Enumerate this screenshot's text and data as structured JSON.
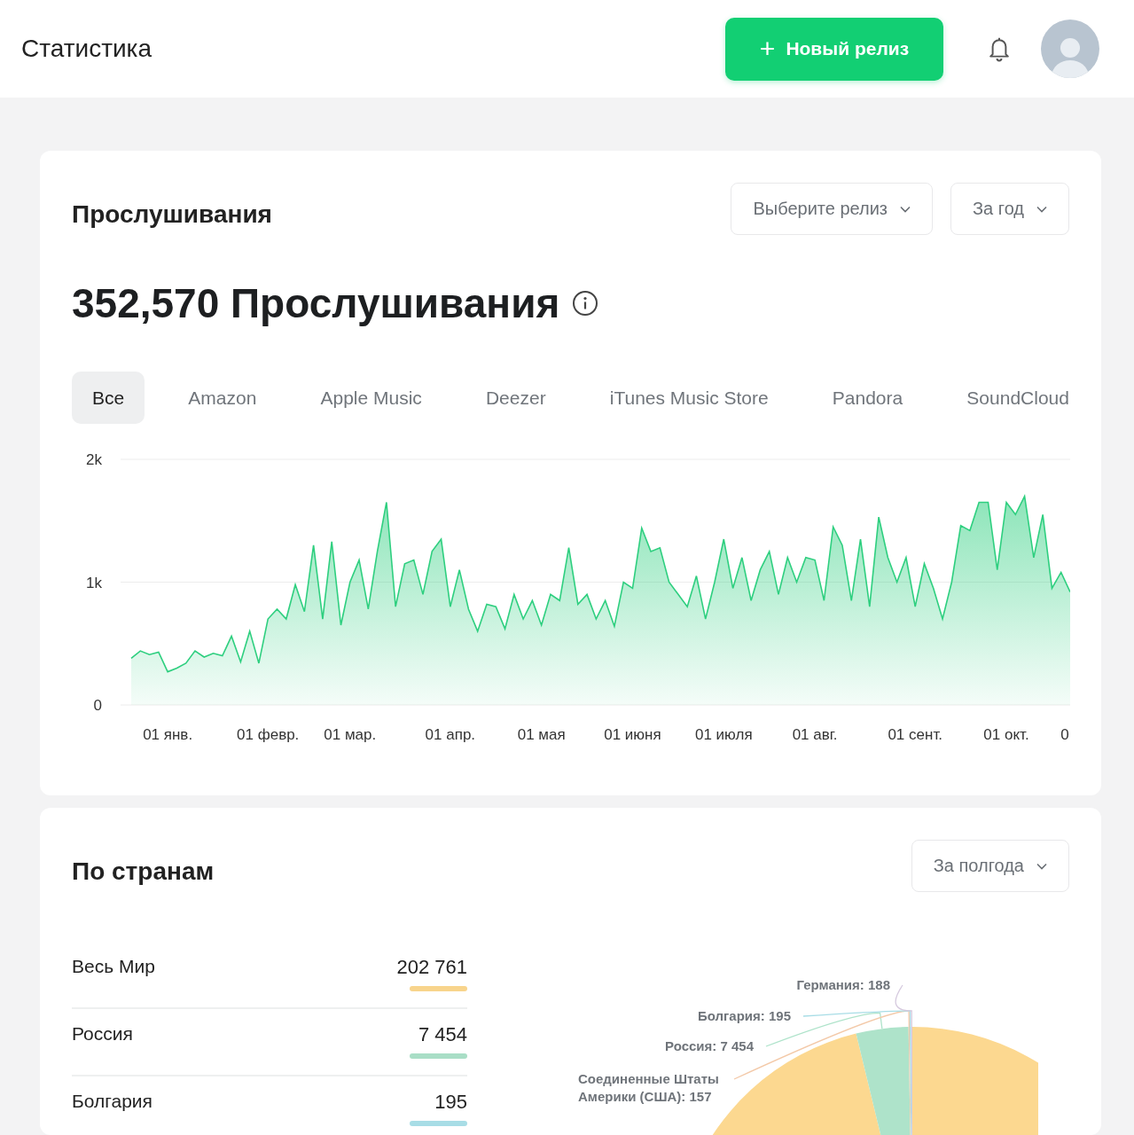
{
  "header": {
    "title": "Статистика",
    "new_release_button": {
      "icon": "+",
      "label": "Новый релиз"
    }
  },
  "plays_card": {
    "title": "Прослушивания",
    "filters": [
      {
        "label": "Выберите релиз"
      },
      {
        "label": "За год"
      }
    ],
    "total": "352,570 Прослушивания",
    "tabs": [
      {
        "label": "Все",
        "selected": true
      },
      {
        "label": "Amazon",
        "selected": false
      },
      {
        "label": "Apple Music",
        "selected": false
      },
      {
        "label": "Deezer",
        "selected": false
      },
      {
        "label": "iTunes Music Store",
        "selected": false
      },
      {
        "label": "Pandora",
        "selected": false
      },
      {
        "label": "SoundCloud",
        "selected": false
      }
    ],
    "chart_data": {
      "type": "area",
      "ylim": [
        0,
        2000
      ],
      "yticks": [
        {
          "value": 0,
          "label": "0"
        },
        {
          "value": 1000,
          "label": "1k"
        },
        {
          "value": 2000,
          "label": "2k"
        }
      ],
      "categories": [
        null,
        null,
        null,
        null,
        "01 янв.",
        null,
        null,
        null,
        null,
        null,
        null,
        null,
        null,
        null,
        null,
        "01 февр.",
        null,
        null,
        null,
        null,
        null,
        null,
        null,
        null,
        "01 мар.",
        null,
        null,
        null,
        null,
        null,
        null,
        null,
        null,
        null,
        null,
        "01 апр.",
        null,
        null,
        null,
        null,
        null,
        null,
        null,
        null,
        null,
        "01 мая",
        null,
        null,
        null,
        null,
        null,
        null,
        null,
        null,
        null,
        "01 июня",
        null,
        null,
        null,
        null,
        null,
        null,
        null,
        null,
        null,
        "01 июля",
        null,
        null,
        null,
        null,
        null,
        null,
        null,
        null,
        null,
        "01 авг.",
        null,
        null,
        null,
        null,
        null,
        null,
        null,
        null,
        null,
        null,
        "01 сент.",
        null,
        null,
        null,
        null,
        null,
        null,
        null,
        null,
        null,
        "01 окт.",
        null,
        null,
        null,
        null,
        null,
        null,
        "0"
      ],
      "series": [
        {
          "color": "#2ecf7f",
          "values": [
            380,
            440,
            410,
            430,
            270,
            300,
            340,
            440,
            390,
            420,
            400,
            560,
            350,
            600,
            340,
            700,
            780,
            700,
            980,
            760,
            1300,
            700,
            1330,
            650,
            1000,
            1180,
            780,
            1250,
            1650,
            800,
            1150,
            1180,
            900,
            1250,
            1350,
            800,
            1100,
            780,
            600,
            820,
            800,
            620,
            900,
            700,
            850,
            650,
            900,
            850,
            1280,
            820,
            900,
            700,
            850,
            640,
            1000,
            950,
            1440,
            1250,
            1280,
            1000,
            900,
            800,
            1050,
            700,
            1000,
            1350,
            950,
            1200,
            850,
            1100,
            1250,
            900,
            1200,
            1000,
            1200,
            1180,
            850,
            1450,
            1300,
            850,
            1350,
            800,
            1530,
            1200,
            1000,
            1200,
            800,
            1150,
            950,
            700,
            1000,
            1460,
            1420,
            1650,
            1650,
            1100,
            1650,
            1550,
            1700,
            1200,
            1550,
            950,
            1080,
            920
          ]
        }
      ]
    }
  },
  "countries_card": {
    "title": "По странам",
    "filter": {
      "label": "За полгода"
    },
    "rows": [
      {
        "name": "Весь Мир",
        "value": "202 761",
        "color": "#f8d48c"
      },
      {
        "name": "Россия",
        "value": "7 454",
        "color": "#a9dec6"
      },
      {
        "name": "Болгария",
        "value": "195",
        "color": "#a8dde6"
      }
    ],
    "chart_data": {
      "type": "pie",
      "values": [
        202761,
        7454,
        157,
        195,
        188
      ],
      "colors": [
        "#fcd890",
        "#aee3ca",
        "#f3c9a8",
        "#a8dde6",
        "#d5c9de"
      ],
      "value_labels": [
        null,
        "Россия: 7 454",
        "Соединенные Штаты Америки (США): 157",
        "Болгария: 195",
        "Германия: 188"
      ]
    }
  }
}
